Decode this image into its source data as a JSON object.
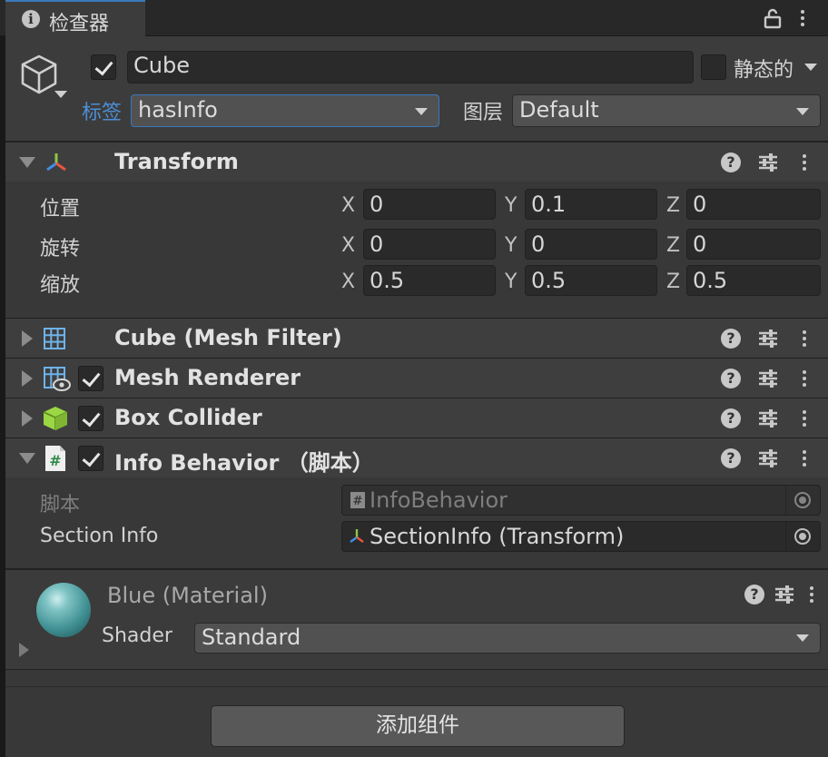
{
  "tab": {
    "title": "检查器"
  },
  "header": {
    "name": "Cube",
    "static_label": "静态的",
    "tag_label": "标签",
    "tag_value": "hasInfo",
    "layer_label": "图层",
    "layer_value": "Default"
  },
  "transform": {
    "title": "Transform",
    "rows": [
      {
        "label": "位置",
        "x": "0",
        "y": "0.1",
        "z": "0"
      },
      {
        "label": "旋转",
        "x": "0",
        "y": "0",
        "z": "0"
      },
      {
        "label": "缩放",
        "x": "0.5",
        "y": "0.5",
        "z": "0.5"
      }
    ],
    "axis_x": "X",
    "axis_y": "Y",
    "axis_z": "Z"
  },
  "components": {
    "mesh_filter": "Cube (Mesh Filter)",
    "mesh_renderer": "Mesh Renderer",
    "box_collider": "Box Collider",
    "info_behavior": "Info Behavior （脚本）"
  },
  "info_behavior": {
    "script_label": "脚本",
    "script_value": "InfoBehavior",
    "section_label": "Section Info",
    "section_value": "SectionInfo (Transform)"
  },
  "material": {
    "title": "Blue (Material)",
    "shader_label": "Shader",
    "shader_value": "Standard"
  },
  "add_component_label": "添加组件",
  "icons": [
    "info-icon",
    "lock-icon",
    "kebab-menu-icon",
    "cube-icon",
    "transform-icon",
    "mesh-filter-icon",
    "mesh-renderer-icon",
    "box-collider-icon",
    "script-icon",
    "help-icon",
    "preset-sliders-icon",
    "object-picker-icon"
  ],
  "colors": {
    "accent": "#3a79bb",
    "collider": "#9bd644",
    "material_sphere": "#4f9ea1"
  }
}
